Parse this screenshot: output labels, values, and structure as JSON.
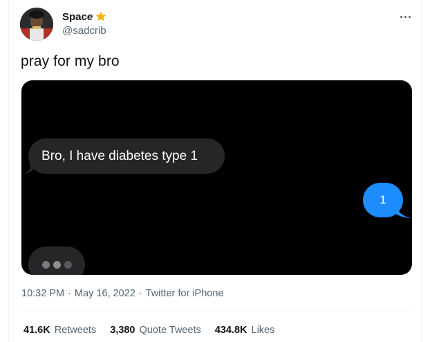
{
  "author": {
    "display_name_prefix": "Spac",
    "display_name_suffix": "e",
    "badge_icon": "star-icon",
    "handle": "@sadcrib",
    "avatar_icon": "avatar-photo"
  },
  "menu": {
    "icon": "more-horizontal-icon"
  },
  "tweet": {
    "text": "pray for my bro"
  },
  "media": {
    "received_message": "Bro, I have diabetes type 1",
    "sent_message": "1",
    "typing_indicator_icon": "typing-dots-icon"
  },
  "meta": {
    "time": "10:32 PM",
    "separator": "·",
    "date": "May 16, 2022",
    "source": "Twitter for iPhone"
  },
  "stats": [
    {
      "value": "41.6K",
      "label": "Retweets"
    },
    {
      "value": "3,380",
      "label": "Quote Tweets"
    },
    {
      "value": "434.8K",
      "label": "Likes"
    }
  ],
  "colors": {
    "text_primary": "#0f1419",
    "text_secondary": "#536471",
    "imessage_blue": "#1c8cff",
    "imessage_gray": "#262628",
    "star": "#f4b400"
  }
}
